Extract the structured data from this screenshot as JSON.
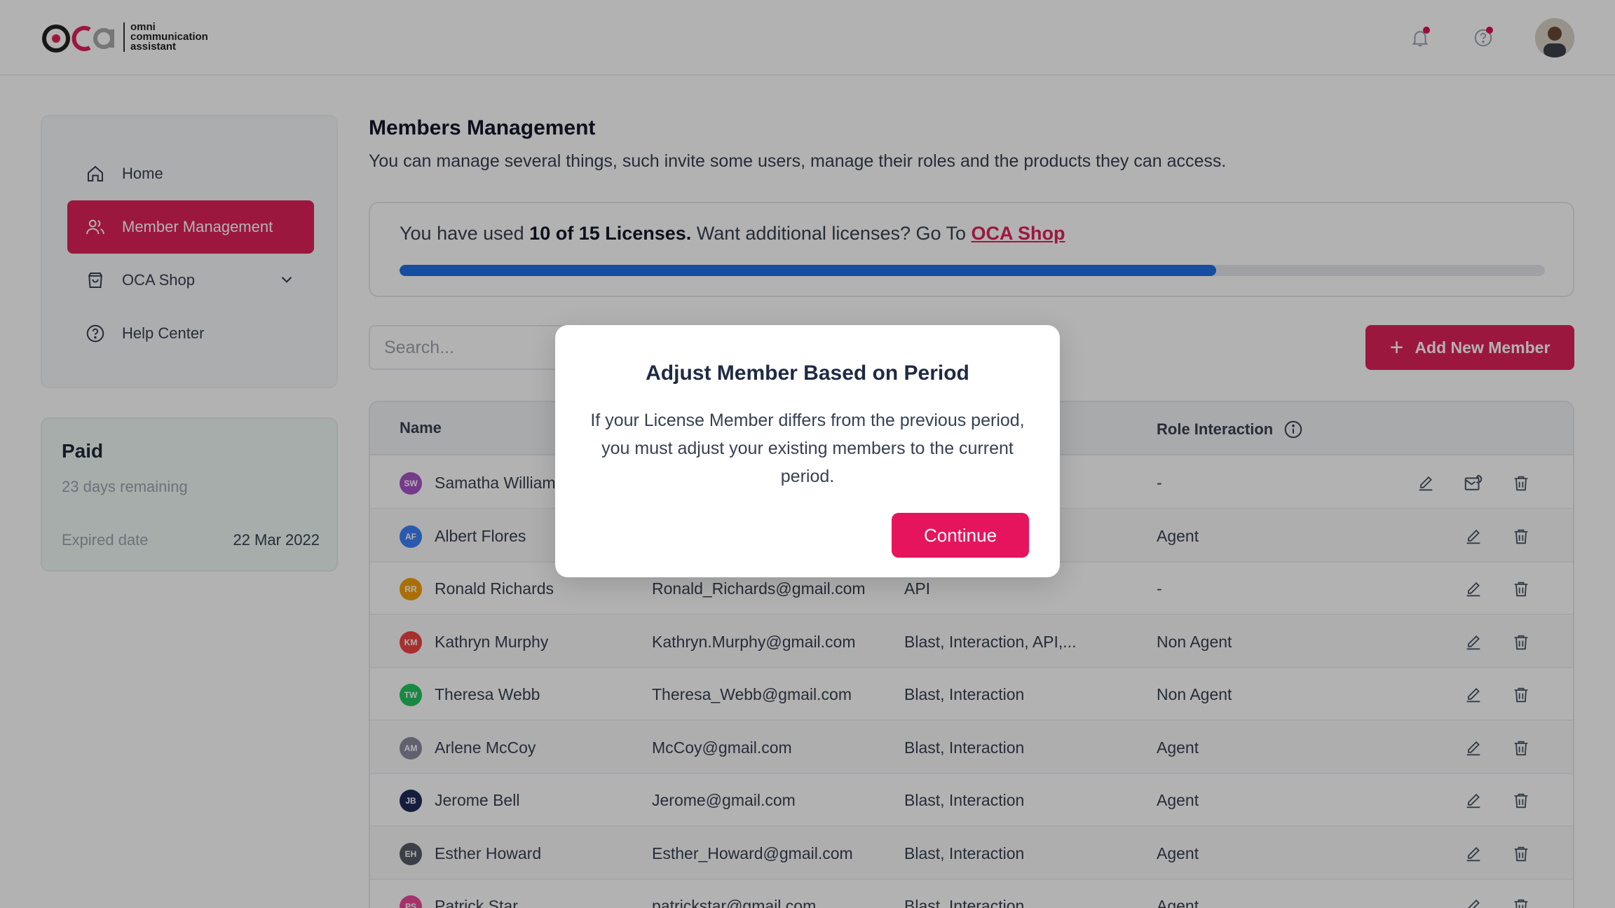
{
  "header": {
    "logo_mark": "oca",
    "logo_text_line1": "omni",
    "logo_text_line2": "communication",
    "logo_text_line3": "assistant",
    "icons": [
      "bell-icon",
      "help-icon"
    ],
    "accent_color": "#e0215a"
  },
  "sidebar": {
    "items": [
      {
        "label": "Home",
        "icon": "home-icon"
      },
      {
        "label": "Member Management",
        "icon": "users-icon",
        "active": true
      },
      {
        "label": "OCA Shop",
        "icon": "shopping-bag-icon"
      },
      {
        "label": "Help Center",
        "icon": "question-circle-icon"
      }
    ]
  },
  "plan": {
    "title": "Paid",
    "remaining": "23 days remaining",
    "expired_label": "Expired date",
    "expired_value": "22 Mar 2022"
  },
  "main": {
    "title": "Members Management",
    "subtitle": "You can manage several things, such invite some users, manage their roles and the products they can access.",
    "license": {
      "prefix": "You have used ",
      "used": "10 of 15 Licenses.",
      "middle": " Want additional licenses? Go To ",
      "link": "OCA Shop",
      "progress_fraction": 0.713
    },
    "search_placeholder": "Search...",
    "add_button": "Add New Member",
    "table": {
      "headers": {
        "name": "Name",
        "role_interaction": "Role Interaction"
      },
      "rows": [
        {
          "initials": "SW",
          "color": "#a855c7",
          "name": "Samatha William",
          "email": "",
          "products": "",
          "role": "-"
        },
        {
          "initials": "AF",
          "color": "#3b82f6",
          "name": "Albert Flores",
          "email": "",
          "products": "",
          "role": "Agent"
        },
        {
          "initials": "RR",
          "color": "#f59e0b",
          "name": "Ronald Richards",
          "email": "Ronald_Richards@gmail.com",
          "products": "API",
          "role": "-"
        },
        {
          "initials": "KM",
          "color": "#ef4444",
          "name": "Kathryn Murphy",
          "email": "Kathryn.Murphy@gmail.com",
          "products": "Blast, Interaction, API,...",
          "role": "Non Agent"
        },
        {
          "initials": "TW",
          "color": "#22c55e",
          "name": "Theresa Webb",
          "email": "Theresa_Webb@gmail.com",
          "products": "Blast, Interaction",
          "role": "Non Agent"
        },
        {
          "initials": "AM",
          "color": "#8b8aa0",
          "name": "Arlene McCoy",
          "email": "McCoy@gmail.com",
          "products": "Blast, Interaction",
          "role": "Agent"
        },
        {
          "initials": "JB",
          "color": "#1e2a5a",
          "name": "Jerome Bell",
          "email": "Jerome@gmail.com",
          "products": "Blast, Interaction",
          "role": "Agent"
        },
        {
          "initials": "EH",
          "color": "#555b66",
          "name": "Esther Howard",
          "email": "Esther_Howard@gmail.com",
          "products": "Blast, Interaction",
          "role": "Agent"
        },
        {
          "initials": "PS",
          "color": "#ec4899",
          "name": "Patrick Star",
          "email": "patrickstar@gmail.com",
          "products": "Blast, Interaction",
          "role": "Agent"
        }
      ]
    }
  },
  "modal": {
    "title": "Adjust Member Based on Period",
    "body": "If your License Member differs from the previous period, you must adjust your existing members to the current period.",
    "button": "Continue"
  }
}
